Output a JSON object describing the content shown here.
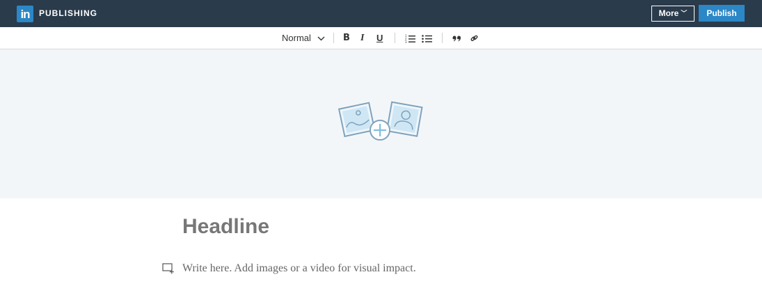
{
  "header": {
    "logo_text": "in",
    "brand": "PUBLISHING",
    "more_label": "More",
    "publish_label": "Publish"
  },
  "toolbar": {
    "style_select": "Normal",
    "bold": "B",
    "italic": "I",
    "underline": "U",
    "icons": [
      "numbered-list-icon",
      "bulleted-list-icon",
      "quote-icon",
      "link-icon"
    ]
  },
  "cover": {
    "icon": "add-images-icon"
  },
  "editor": {
    "headline_placeholder": "Headline",
    "body_placeholder": "Write here. Add images or a video for visual impact."
  },
  "colors": {
    "topbar": "#2a3b4b",
    "accent": "#2b87c6",
    "cover_bg": "#f3f6f9",
    "icon_stroke": "#7fa3bd",
    "icon_fill": "#cfe6f4"
  }
}
